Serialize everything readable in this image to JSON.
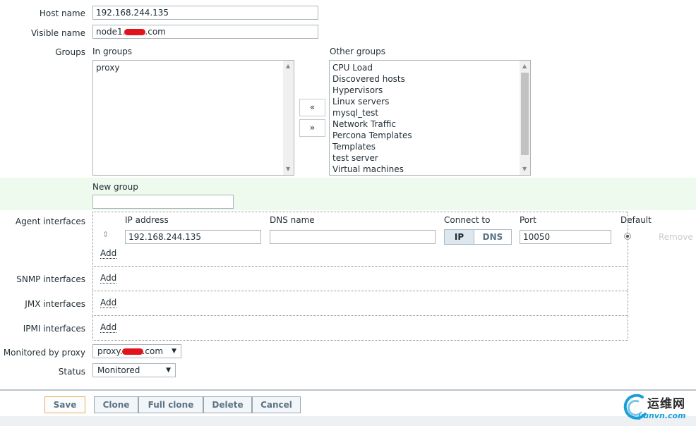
{
  "form": {
    "host_name": {
      "label": "Host name",
      "value": "192.168.244.135"
    },
    "visible_name": {
      "label": "Visible name",
      "value_prefix": "node1.",
      "value_suffix": ".com"
    },
    "groups": {
      "label": "Groups",
      "in_groups_label": "In groups",
      "in_groups": [
        "proxy"
      ],
      "other_groups_label": "Other groups",
      "other_groups": [
        "CPU Load",
        "Discovered hosts",
        "Hypervisors",
        "Linux servers",
        "mysql_test",
        "Network Traffic",
        "Percona Templates",
        "Templates",
        "test server",
        "Virtual machines"
      ],
      "move_left_label": "«",
      "move_right_label": "»"
    },
    "new_group": {
      "label": "New group",
      "value": ""
    },
    "agent_interfaces": {
      "label": "Agent interfaces",
      "col_ip": "IP address",
      "col_dns": "DNS name",
      "col_connect": "Connect to",
      "col_port": "Port",
      "col_default": "Default",
      "row": {
        "ip": "192.168.244.135",
        "dns": "",
        "connect_ip": "IP",
        "connect_dns": "DNS",
        "port": "10050",
        "remove": "Remove"
      },
      "add": "Add"
    },
    "snmp_interfaces": {
      "label": "SNMP interfaces",
      "add": "Add"
    },
    "jmx_interfaces": {
      "label": "JMX interfaces",
      "add": "Add"
    },
    "ipmi_interfaces": {
      "label": "IPMI interfaces",
      "add": "Add"
    },
    "monitored_by_proxy": {
      "label": "Monitored by proxy",
      "value_prefix": "proxy.",
      "value_suffix": ".com"
    },
    "status": {
      "label": "Status",
      "value": "Monitored"
    }
  },
  "buttons": {
    "save": "Save",
    "clone": "Clone",
    "full_clone": "Full clone",
    "delete": "Delete",
    "cancel": "Cancel"
  },
  "watermark": {
    "chinese": "运维网",
    "domain": "yunvn.com"
  },
  "colors": {
    "accent_orange": "#f3a95a",
    "new_group_bg": "#eefaee",
    "button_text": "#5b7384"
  }
}
